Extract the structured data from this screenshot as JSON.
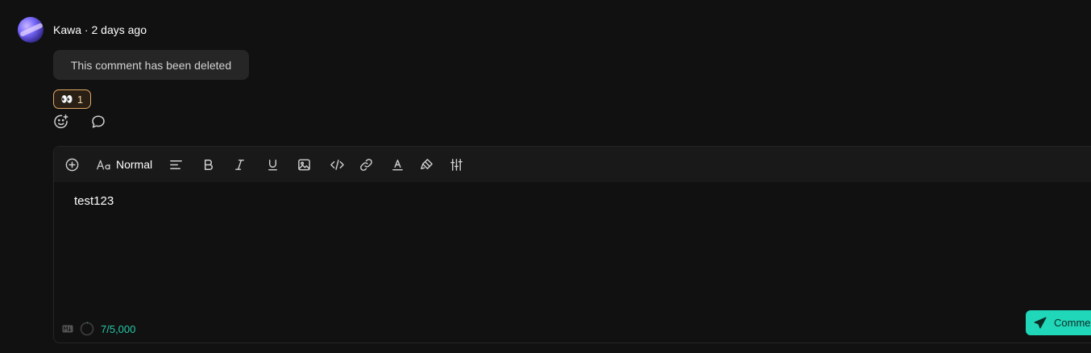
{
  "comment": {
    "author": "Kawa",
    "separator": " · ",
    "time": "2 days ago",
    "deleted_text": "This comment has been deleted",
    "reaction": {
      "emoji": "👀",
      "count": "1"
    }
  },
  "icons": {
    "add_reaction": "smile-plus-icon",
    "reply": "speech-bubble-icon"
  },
  "editor": {
    "format_label": "Normal",
    "content": "test123",
    "char_count": "7/5,000",
    "submit_label": "Comment"
  },
  "colors": {
    "accent": "#21d7b9",
    "counter": "#27c9a9",
    "reaction_border": "#e0a866",
    "background": "#111111"
  }
}
